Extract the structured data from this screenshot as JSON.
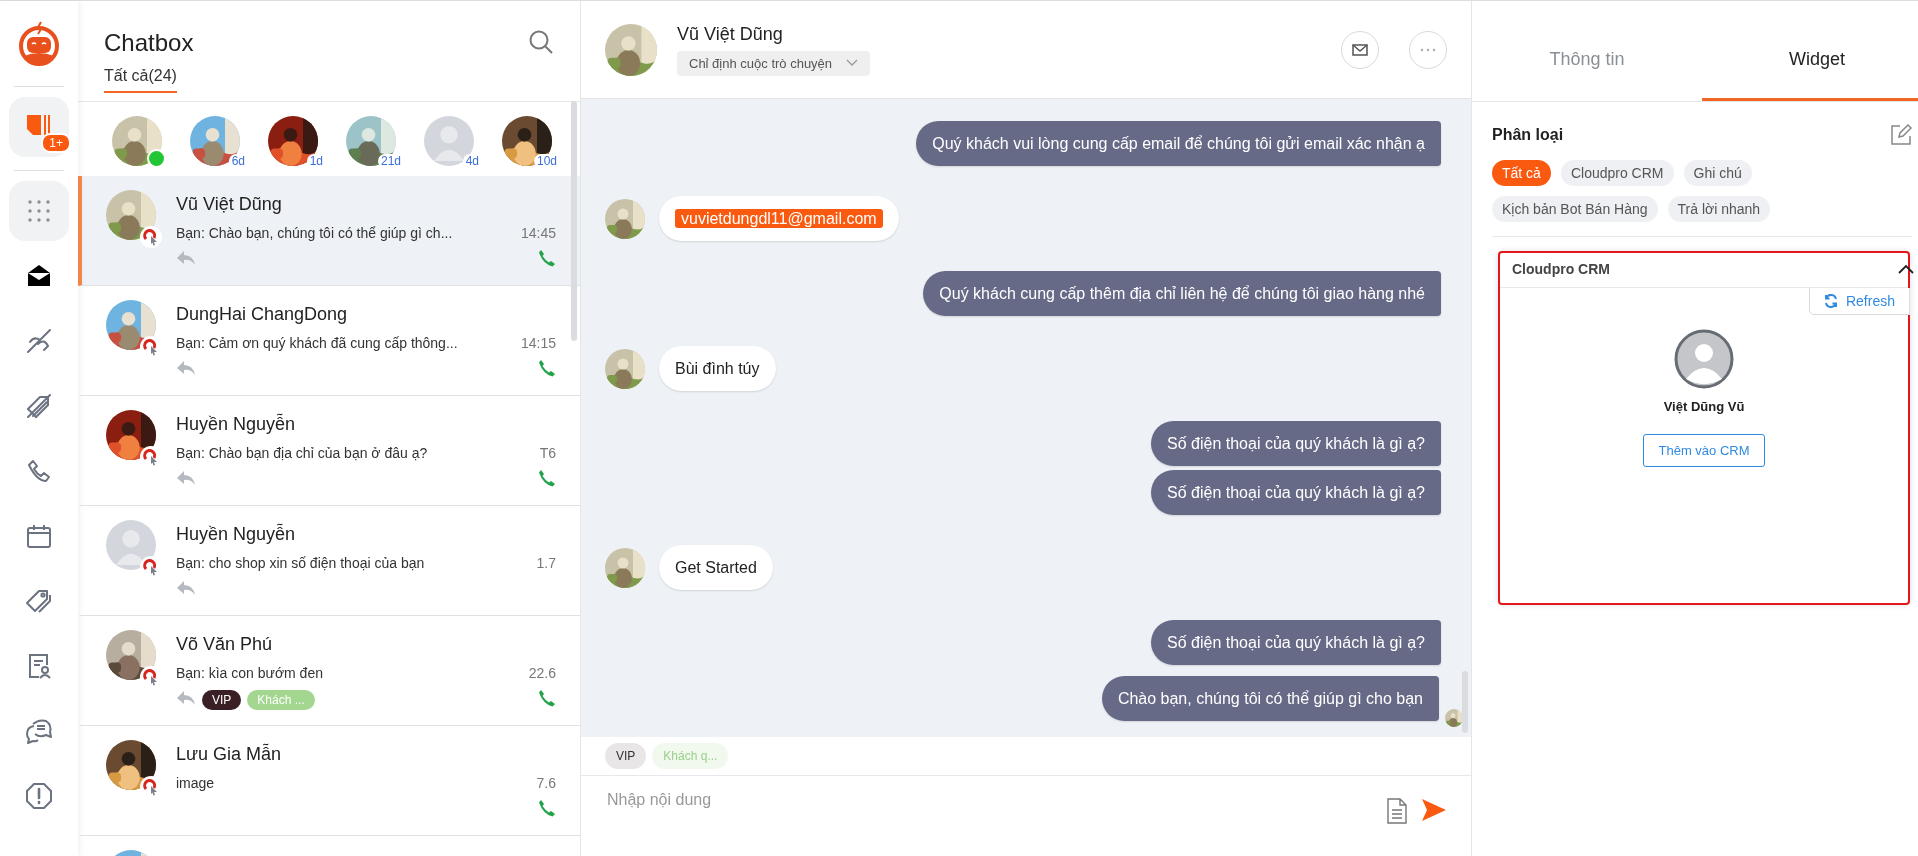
{
  "rail": [
    {
      "kind": "logo",
      "selected": false
    },
    {
      "kind": "inbox",
      "selected": true,
      "badge": "1+"
    },
    {
      "kind": "apps",
      "selected": true
    },
    {
      "kind": "mail",
      "selected": false
    },
    {
      "kind": "phone-off",
      "selected": false
    },
    {
      "kind": "tag-off",
      "selected": false
    },
    {
      "kind": "phone",
      "selected": false
    },
    {
      "kind": "calendar",
      "selected": false
    },
    {
      "kind": "tag",
      "selected": false
    },
    {
      "kind": "contact-doc",
      "selected": false
    },
    {
      "kind": "chat",
      "selected": false
    },
    {
      "kind": "alert",
      "selected": false
    }
  ],
  "chatlist": {
    "title": "Chatbox",
    "filter": {
      "label": "Tất cả(24)",
      "selected": true
    },
    "stories": [
      {
        "photo": true,
        "online": true
      },
      {
        "photo": true,
        "online": false,
        "badge": "6d"
      },
      {
        "photo": true,
        "online": false,
        "badge": "1d"
      },
      {
        "photo": true,
        "online": false,
        "badge": "21d"
      },
      {
        "photo": false,
        "online": false,
        "badge": "4d"
      },
      {
        "photo": true,
        "online": false,
        "badge": "10d"
      }
    ],
    "conversations": [
      {
        "name": "Vũ Việt Dũng",
        "preview": "Bạn: Chào bạn, chúng tôi có thể giúp gì ch...",
        "time": "14:45",
        "photo": true,
        "selected": true,
        "replied": true,
        "call": true
      },
      {
        "name": "DungHai ChangDong",
        "preview": "Bạn: Cảm ơn quý khách đã cung cấp thông...",
        "time": "14:15",
        "photo": true,
        "selected": false,
        "replied": true,
        "call": true
      },
      {
        "name": "Huyền Nguyễn",
        "preview": "Bạn: Chào bạn địa chỉ của bạn ở đâu ạ?",
        "time": "T6",
        "photo": true,
        "selected": false,
        "replied": true,
        "call": true
      },
      {
        "name": "Huyền Nguyễn",
        "preview": "Bạn: cho shop xin số điện thoại của bạn",
        "time": "1.7",
        "photo": false,
        "selected": false,
        "replied": true,
        "call": false
      },
      {
        "name": "Võ Văn Phú",
        "preview": "Bạn: kìa con bướm đen",
        "time": "22.6",
        "photo": true,
        "selected": false,
        "replied": true,
        "call": true,
        "tags": [
          {
            "label": "VIP",
            "color": "#3a1f24"
          },
          {
            "label": "Khách ...",
            "color": "#a3d68f"
          }
        ]
      },
      {
        "name": "Lưu Gia Mẫn",
        "preview": "image",
        "time": "7.6",
        "photo": true,
        "selected": false,
        "replied": false,
        "call": true
      }
    ]
  },
  "chat": {
    "name": "Vũ Việt Dũng",
    "assign": "Chỉ định cuộc trò chuyện",
    "messages": [
      {
        "kind": "agent",
        "text": "Quý khách vui lòng cung cấp email để chúng tôi gửi email xác nhận ạ",
        "highlight": false,
        "seen": false
      },
      {
        "kind": "customer",
        "text": "vuvietdungdl11@gmail.com",
        "highlight": true,
        "seen": false
      },
      {
        "kind": "agent",
        "text": "Quý khách cung cấp thêm địa chỉ liên hệ để chúng tôi giao hàng nhé",
        "highlight": false,
        "seen": false
      },
      {
        "kind": "customer",
        "text": "Bùi đình túy",
        "highlight": false,
        "seen": false
      },
      {
        "kind": "agent",
        "text": "Số điện thoại của quý khách là gì ạ?",
        "highlight": false,
        "seen": false
      },
      {
        "kind": "agent",
        "text": "Số điện thoại của quý khách là gì ạ?",
        "highlight": false,
        "seen": false
      },
      {
        "kind": "customer",
        "text": "Get Started",
        "highlight": false,
        "seen": false
      },
      {
        "kind": "agent",
        "text": "Số điện thoại của quý khách là gì ạ?",
        "highlight": false,
        "seen": false
      },
      {
        "kind": "agent",
        "text": "Chào bạn, chúng tôi có thể giúp gì cho bạn",
        "highlight": false,
        "seen": true
      }
    ],
    "tags": [
      {
        "label": "VIP",
        "color": "#e9e6e8"
      },
      {
        "label": "Khách q...",
        "color": "#f1f8ee"
      }
    ],
    "input": {
      "placeholder": "Nhập nội dung"
    }
  },
  "panel": {
    "tabs": [
      {
        "label": "Thông tin",
        "selected": false
      },
      {
        "label": "Widget",
        "selected": true
      }
    ],
    "section": "Phân loại",
    "chips": [
      {
        "label": "Tất cả",
        "selected": true
      },
      {
        "label": "Cloudpro CRM",
        "selected": false
      },
      {
        "label": "Ghi chú",
        "selected": false
      },
      {
        "label": "Kịch bản Bot Bán Hàng",
        "selected": false
      },
      {
        "label": "Trả lời nhanh",
        "selected": false
      }
    ],
    "crm": {
      "title": "Cloudpro CRM",
      "expanded": true,
      "highlighted": true,
      "refresh": "Refresh",
      "contact": "Việt Dũng Vũ",
      "add": "Thêm vào CRM"
    }
  }
}
